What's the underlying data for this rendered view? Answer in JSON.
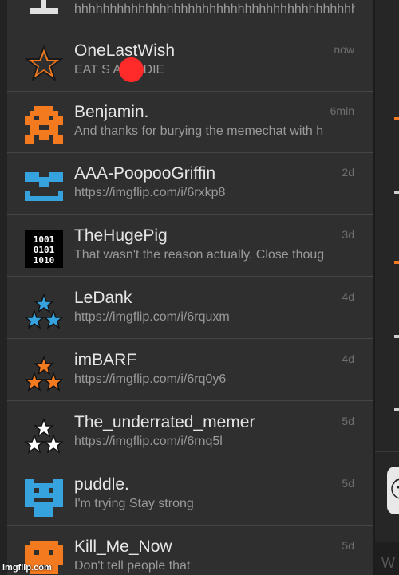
{
  "colors": {
    "orange": "#f47a20",
    "blue": "#36a3df",
    "white": "#ffffff"
  },
  "chats": [
    {
      "message": "hhhhhhhhhhhhhhhhhhhhhhhhhhhhhhhhhhhhhhhhhh"
    },
    {
      "name": "OneLastWish",
      "message": "EAT S   AND DIE",
      "time": "now",
      "avatar": "star-outline-icon"
    },
    {
      "name": "Benjamin.",
      "message": "And thanks for burying the memechat with h",
      "time": "6min",
      "avatar": "pixel-monster-icon"
    },
    {
      "name": "AAA-PoopooGriffin",
      "message": "https://imgflip.com/i/6rxkp8",
      "time": "2d",
      "avatar": "pixel-face-icon"
    },
    {
      "name": "TheHugePig",
      "message": "That wasn't the reason actually. Close thoug",
      "time": "3d",
      "avatar": "binary-icon"
    },
    {
      "name": "LeDank",
      "message": "https://imgflip.com/i/6rquxm",
      "time": "4d",
      "avatar": "three-stars-icon"
    },
    {
      "name": "imBARF",
      "message": "https://imgflip.com/i/6rq0y6",
      "time": "4d",
      "avatar": "three-stars-icon"
    },
    {
      "name": "The_underrated_memer",
      "message": "https://imgflip.com/i/6rnq5l",
      "time": "5d",
      "avatar": "three-stars-icon"
    },
    {
      "name": "puddle.",
      "message": "I'm trying Stay strong",
      "time": "5d",
      "avatar": "pixel-face-icon"
    },
    {
      "name": "Kill_Me_Now",
      "message": "Don't tell people that",
      "time": "5d",
      "avatar": "pixel-monster-icon"
    }
  ],
  "right_panel": {
    "letter": "W",
    "avatar": "user-avatar-icon"
  },
  "watermark": "imgflip.com"
}
